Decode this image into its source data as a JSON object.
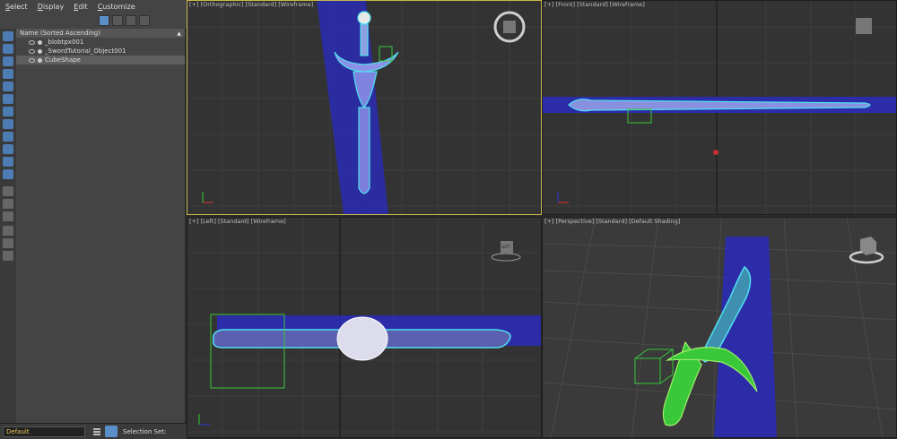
{
  "menu": [
    "Select",
    "Display",
    "Edit",
    "Customize"
  ],
  "scene_explorer": {
    "header": "Name (Sorted Ascending)",
    "items": [
      {
        "name": "_blobtpx001",
        "selected": false
      },
      {
        "name": "_SwordTutorial_Object001",
        "selected": false
      },
      {
        "name": "CubeShape",
        "selected": true
      }
    ]
  },
  "status": {
    "layer": "Default",
    "selection_set_label": "Selection Set:"
  },
  "viewports": {
    "top": {
      "label": "[+] [Orthographic] [Standard] [Wireframe]"
    },
    "front": {
      "label": "[+] [Front] [Standard] [Wireframe]"
    },
    "left": {
      "label": "[+] [Left] [Standard] [Wireframe]",
      "viewcube": "LEFT"
    },
    "perspective": {
      "label": "[+] [Perspective] [Standard] [Default Shading]"
    }
  },
  "colors": {
    "accent": "#5b8fc9",
    "layer_text": "#e8c35a",
    "wire_blue": "#2b2bb5",
    "wire_cyan": "#4fe0f0",
    "wire_green": "#38c83a",
    "active_border": "#c8b84a"
  }
}
